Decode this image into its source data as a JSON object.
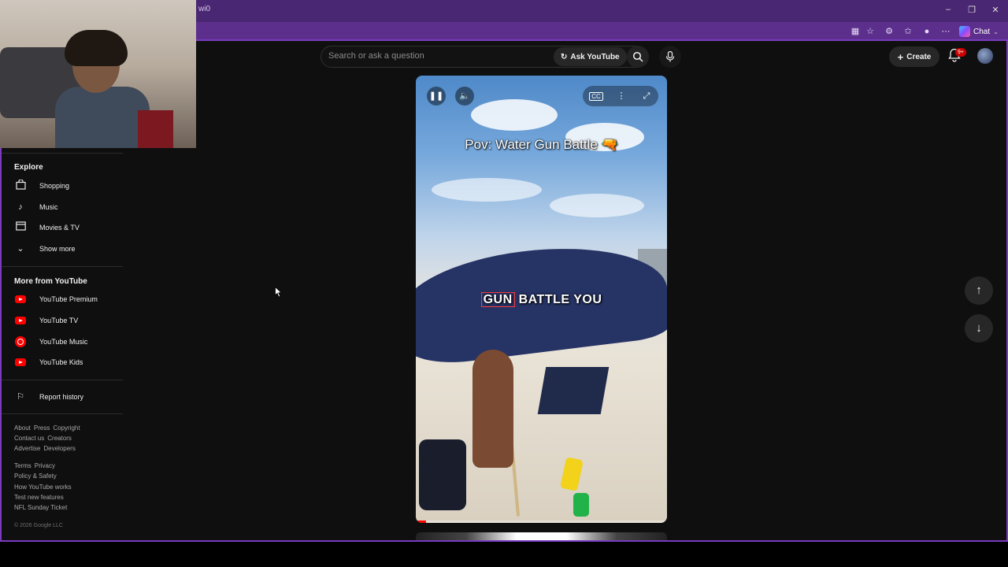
{
  "browser": {
    "address_fragment": "wi0",
    "chat_label": "Chat",
    "window_controls": [
      "minimize",
      "restore",
      "close"
    ],
    "toolbar_icons": [
      "split-screen-icon",
      "favorite-icon",
      "extensions-icon",
      "favorites-icon",
      "profile-icon",
      "more-icon"
    ]
  },
  "header": {
    "search_placeholder": "Search or ask a question",
    "ask_label": "Ask YouTube",
    "create_label": "Create",
    "notification_badge": "9+"
  },
  "sidebar": {
    "explore_title": "Explore",
    "explore_items": [
      {
        "label": "Shopping",
        "icon": "shopping-bag-icon"
      },
      {
        "label": "Music",
        "icon": "music-note-icon"
      },
      {
        "label": "Movies & TV",
        "icon": "clapperboard-icon"
      },
      {
        "label": "Show more",
        "icon": "chevron-down-icon"
      }
    ],
    "more_title": "More from YouTube",
    "more_items": [
      {
        "label": "YouTube Premium"
      },
      {
        "label": "YouTube TV"
      },
      {
        "label": "YouTube Music"
      },
      {
        "label": "YouTube Kids"
      }
    ],
    "report_history": "Report history",
    "footer1": [
      "About",
      "Press",
      "Copyright",
      "Contact us",
      "Creators",
      "Advertise",
      "Developers"
    ],
    "footer2": [
      "Terms",
      "Privacy",
      "Policy & Safety",
      "How YouTube works",
      "Test new features",
      "NFL Sunday Ticket"
    ],
    "copyright": "© 2026 Google LLC"
  },
  "video": {
    "title_overlay": "Pov: Water Gun Battle",
    "caption_highlight": "GUN",
    "caption_rest": "BATTLE YOU",
    "progress_fraction": 0.04
  },
  "colors": {
    "frame": "#7a3bbf",
    "accent_red": "#ff0000",
    "page_bg": "#0f0f0f"
  }
}
